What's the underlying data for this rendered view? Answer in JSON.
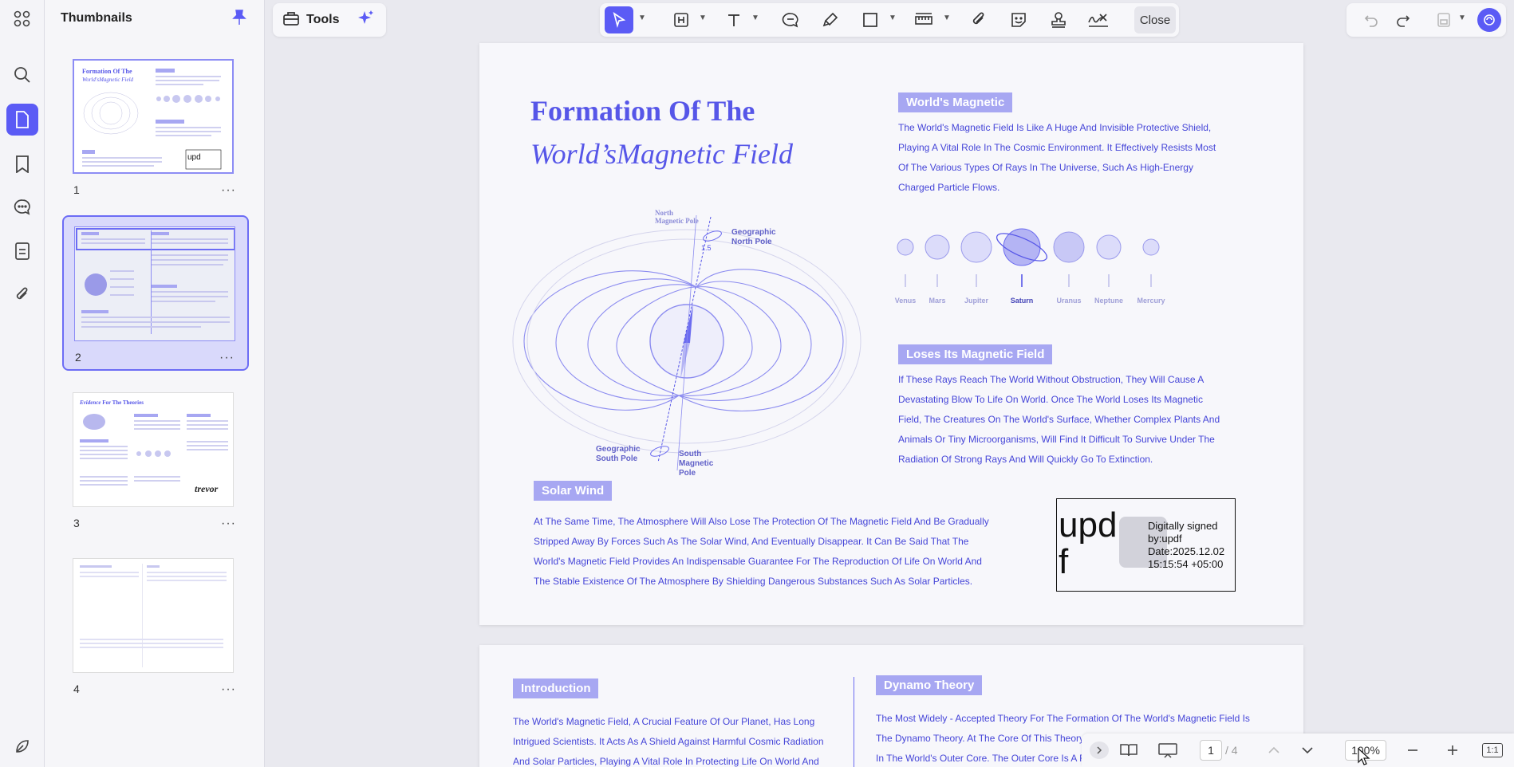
{
  "rail": {
    "items": [
      "grid",
      "search",
      "pages",
      "bookmark",
      "comments",
      "forms",
      "attachments"
    ],
    "bottom": "theme"
  },
  "thumbnails": {
    "title": "Thumbnails",
    "pages": [
      {
        "number": "1",
        "selected": false
      },
      {
        "number": "2",
        "selected": true
      },
      {
        "number": "3",
        "selected": false
      },
      {
        "number": "4",
        "selected": false
      }
    ],
    "more_label": "···",
    "thumb3_title_italic": "Evidence",
    "thumb3_title": " For The Theories",
    "thumb3_sig": "trevor",
    "thumb1_title_a": "Formation Of The",
    "thumb1_title_b": "World'sMagnetic Field",
    "thumb1_logo": "upd"
  },
  "toolbar": {
    "tools_label": "Tools",
    "close_label": "Close"
  },
  "page1": {
    "title_line1": "Formation Of The",
    "title_line2": "World’sMagnetic Field",
    "worlds_magnetic": {
      "tag": "World's Magnetic",
      "lines": [
        "The World's Magnetic Field Is Like A Huge And Invisible Protective Shield,",
        "Playing A Vital Role In The Cosmic Environment. It Effectively Resists Most",
        "Of The Various Types Of Rays In The Universe, Such As High-Energy",
        "Charged Particle Flows."
      ]
    },
    "planets": [
      "Venus",
      "Mars",
      "Jupiter",
      "Saturn",
      "Uranus",
      "Neptune",
      "Mercury"
    ],
    "diagram_labels": {
      "north_mag": "North",
      "north_mag2": "Magnetic Pole",
      "geo_north": "Geographic",
      "geo_north2": "North Pole",
      "geo_south": "Geographic",
      "geo_south2": "South Pole",
      "south_mag": "South",
      "south_mag2": "Magnetic",
      "south_mag3": "Pole",
      "angle": "1.5"
    },
    "loses": {
      "tag": "Loses Its Magnetic Field",
      "lines": [
        "If These Rays Reach The World Without Obstruction, They Will Cause A",
        "Devastating Blow To Life On World. Once The World Loses Its Magnetic",
        "Field, The Creatures On The World's Surface, Whether Complex Plants And",
        "Animals Or Tiny Microorganisms, Will Find It Difficult To Survive Under The",
        "Radiation Of Strong Rays And Will Quickly Go To Extinction."
      ]
    },
    "solar": {
      "tag": "Solar Wind",
      "lines": [
        "At The Same Time, The Atmosphere Will Also Lose The Protection Of The Magnetic Field And Be Gradually",
        "Stripped Away By Forces Such As The Solar Wind, And Eventually Disappear. It Can Be Said That The",
        "World's Magnetic Field Provides An Indispensable Guarantee For The Reproduction Of Life On World And",
        "The Stable Existence Of The Atmosphere By Shielding Dangerous Substances Such As Solar Particles."
      ]
    },
    "signature": {
      "logo_line1": "upd",
      "logo_line2": "f",
      "lines": [
        "Digitally signed",
        "by:updf",
        "Date:2025.12.02",
        "15:15:54 +05:00"
      ]
    }
  },
  "page2": {
    "intro": {
      "tag": "Introduction",
      "lines": [
        "The World's Magnetic Field, A Crucial Feature Of Our Planet, Has Long",
        "Intrigued Scientists. It Acts As A Shield Against Harmful Cosmic Radiation",
        "And Solar Particles, Playing A Vital Role In Protecting Life On World And"
      ]
    },
    "dynamo": {
      "tag": "Dynamo Theory",
      "lines": [
        "The Most Widely - Accepted Theory For The Formation Of The World's Magnetic Field Is",
        "The Dynamo Theory. At The Core Of This Theory",
        "In The World's Outer Core. The Outer Core Is A F"
      ]
    }
  },
  "statusbar": {
    "current_page": "1",
    "total_pages": "/ 4",
    "zoom": "100%",
    "fit_label": "1:1"
  },
  "colors": {
    "accent": "#5b5bf5",
    "text_blue": "#4545d8",
    "tag_bg": "#a7a7f2"
  }
}
